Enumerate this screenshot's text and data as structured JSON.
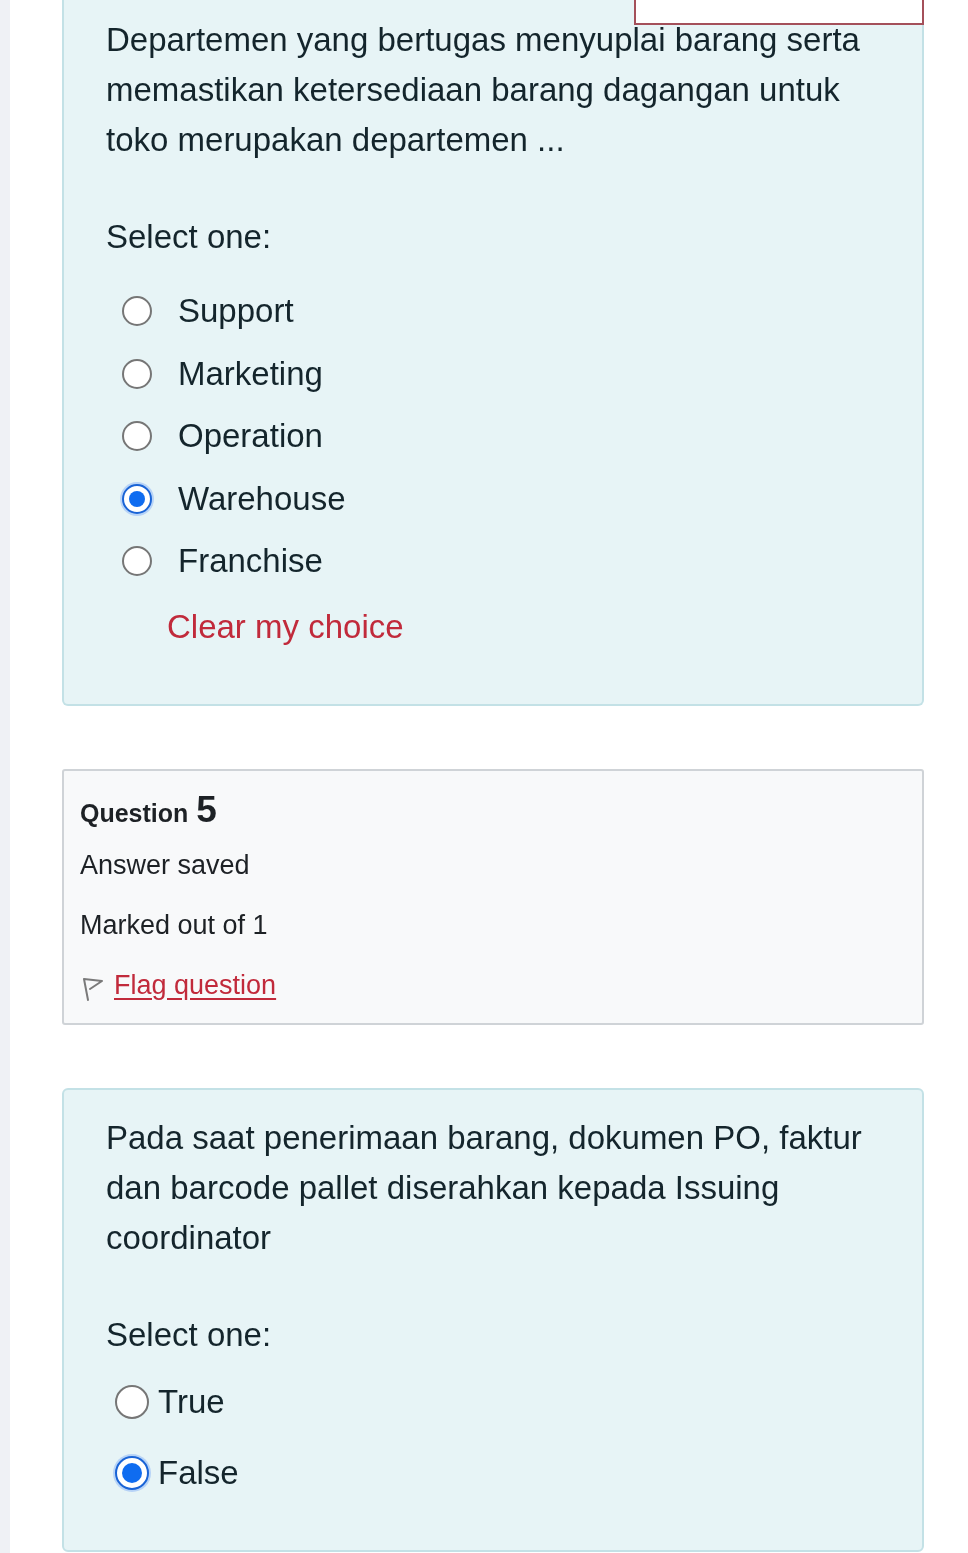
{
  "questions": [
    {
      "kind": "multichoice",
      "text": "Departemen yang bertugas menyuplai barang serta memastikan ketersediaan barang dagangan untuk toko merupakan departemen ...",
      "prompt": "Select one:",
      "options": [
        {
          "label": "Support",
          "selected": false
        },
        {
          "label": "Marketing",
          "selected": false
        },
        {
          "label": "Operation",
          "selected": false
        },
        {
          "label": "Warehouse",
          "selected": true
        },
        {
          "label": "Franchise",
          "selected": false
        }
      ],
      "clear_link": "Clear my choice"
    },
    {
      "kind": "info",
      "title": "Question",
      "number": "5",
      "status": "Answer saved",
      "marks": "Marked out of 1",
      "flag_link": "Flag question"
    },
    {
      "kind": "truefalse",
      "text": "Pada saat penerimaan barang, dokumen PO, faktur dan barcode pallet diserahkan kepada Issuing coordinator",
      "prompt": "Select one:",
      "options": [
        {
          "label": "True",
          "selected": false
        },
        {
          "label": "False",
          "selected": true
        }
      ]
    }
  ]
}
